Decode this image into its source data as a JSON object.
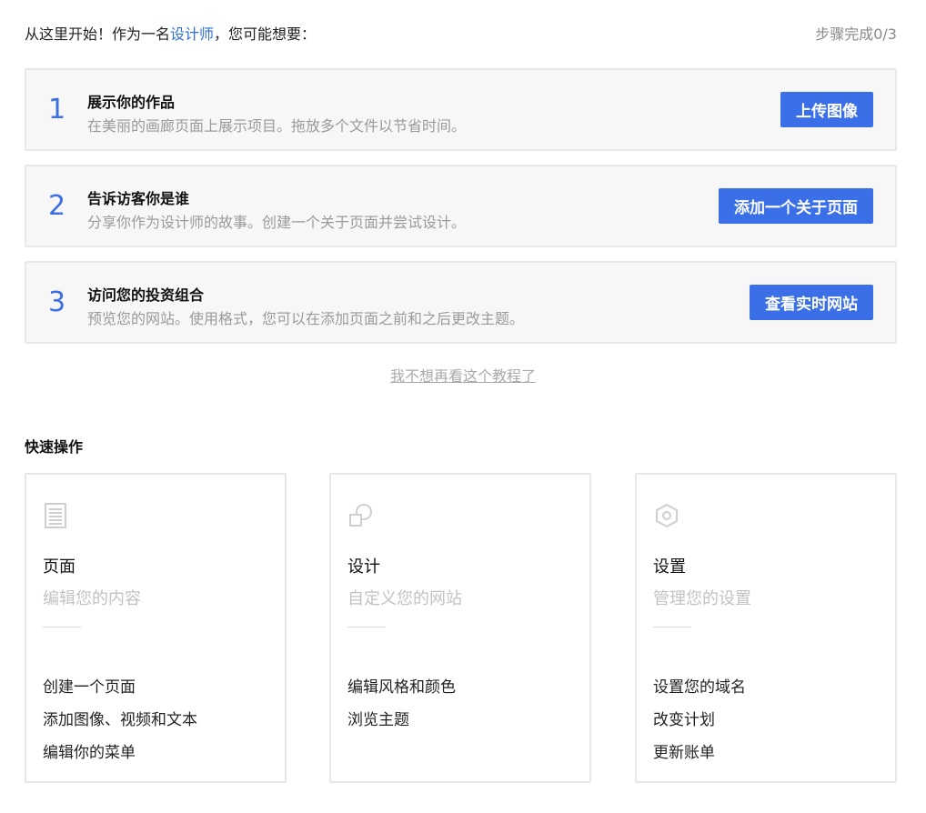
{
  "header": {
    "title_prefix": "从这里开始！作为一名",
    "title_role": "设计师",
    "title_suffix": "，您可能想要：",
    "progress": "步骤完成0/3"
  },
  "steps": [
    {
      "number": "1",
      "title": "展示你的作品",
      "description": "在美丽的画廊页面上展示项目。拖放多个文件以节省时间。",
      "button": "上传图像"
    },
    {
      "number": "2",
      "title": "告诉访客你是谁",
      "description": "分享你作为设计师的故事。创建一个关于页面并尝试设计。",
      "button": "添加一个关于页面"
    },
    {
      "number": "3",
      "title": "访问您的投资组合",
      "description": "预览您的网站。使用格式，您可以在添加页面之前和之后更改主题。",
      "button": "查看实时网站"
    }
  ],
  "dismiss_link": "我不想再看这个教程了",
  "quick_actions": {
    "title": "快速操作",
    "cards": [
      {
        "icon": "page-icon",
        "title": "页面",
        "subtitle": "编辑您的内容",
        "links": [
          "创建一个页面",
          "添加图像、视频和文本",
          "编辑你的菜单"
        ]
      },
      {
        "icon": "design-shapes-icon",
        "title": "设计",
        "subtitle": "自定义您的网站",
        "links": [
          "编辑风格和颜色",
          "浏览主题"
        ]
      },
      {
        "icon": "settings-hexagon-icon",
        "title": "设置",
        "subtitle": "管理您的设置",
        "links": [
          "设置您的域名",
          "改变计划",
          "更新账单"
        ]
      }
    ]
  },
  "colors": {
    "accent": "#3a6fe8",
    "role_link": "#2f6fd4",
    "muted_text": "#9a9a9a",
    "card_bg": "#f7f7f8"
  }
}
